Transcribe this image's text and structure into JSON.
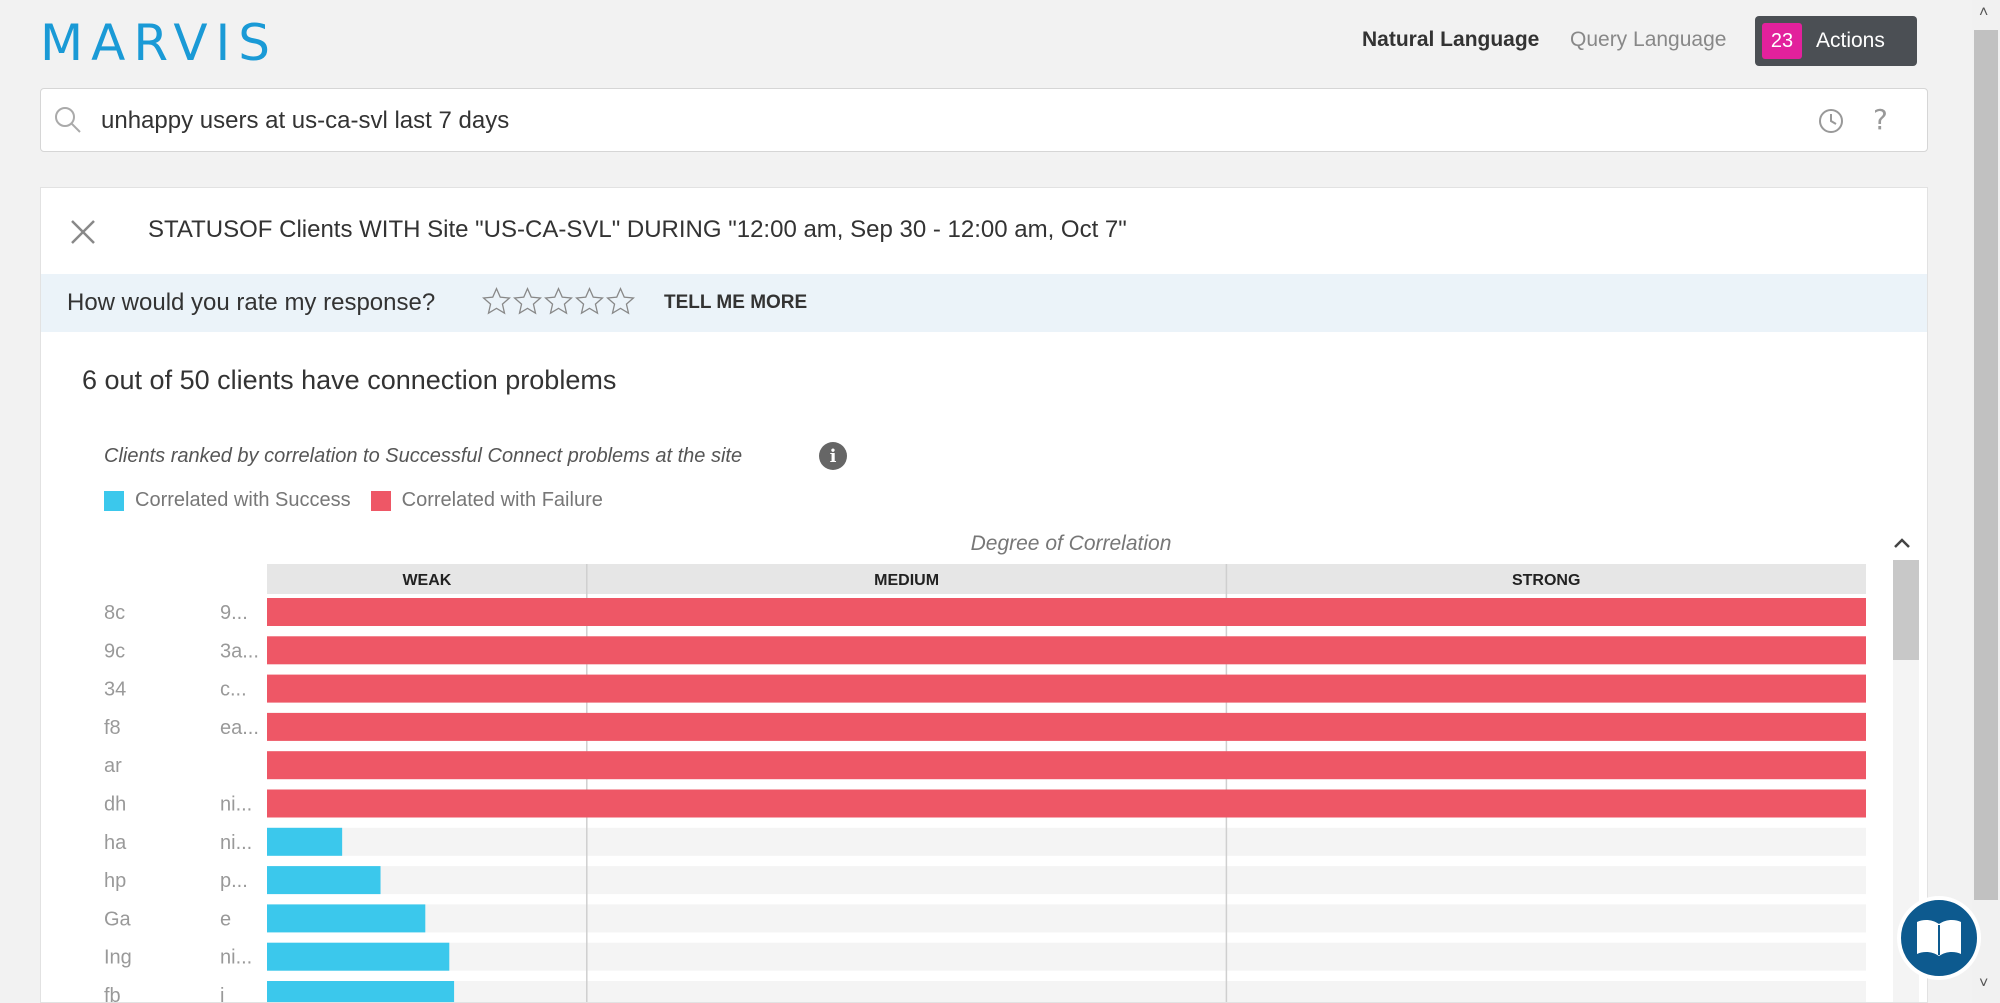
{
  "header": {
    "logo": "MARVIS",
    "mode_natural": "Natural Language",
    "mode_query": "Query Language",
    "actions_count": "23",
    "actions_label": "Actions"
  },
  "search": {
    "value": "unhappy users at us-ca-svl last 7 days"
  },
  "result": {
    "query_text": "STATUSOF Clients WITH Site \"US-CA-SVL\" DURING \"12:00 am, Sep 30 - 12:00 am, Oct 7\"",
    "rating_question": "How would you rate my response?",
    "rating_stars": 0,
    "rating_max": 5,
    "tell_more": "TELL ME MORE",
    "summary": "6 out of 50 clients have connection problems",
    "chart_subtitle": "Clients ranked by correlation to Successful Connect problems at the site",
    "info_icon": "i"
  },
  "colors": {
    "success": "#3bc8ec",
    "failure": "#ee5766",
    "logo": "#1a9ad6",
    "actions_badge": "#e2219c"
  },
  "chart_data": {
    "type": "bar",
    "orientation": "horizontal",
    "title": "Clients ranked by correlation to Successful Connect problems at the site",
    "xlabel": "Degree of Correlation",
    "bands": [
      "WEAK",
      "MEDIUM",
      "STRONG"
    ],
    "legend": [
      {
        "name": "Correlated with Success",
        "color": "#3bc8ec"
      },
      {
        "name": "Correlated with Failure",
        "color": "#ee5766"
      }
    ],
    "legend_position": "top-left",
    "xlim": [
      0,
      1
    ],
    "categories": [
      {
        "left": "8c",
        "right": "9..."
      },
      {
        "left": "9c",
        "right": "3a..."
      },
      {
        "left": "34",
        "right": "c..."
      },
      {
        "left": "f8",
        "right": "ea..."
      },
      {
        "left": "ar",
        "right": ""
      },
      {
        "left": "dh",
        "right": "ni..."
      },
      {
        "left": "ha",
        "right": "ni..."
      },
      {
        "left": "hp",
        "right": "p..."
      },
      {
        "left": "Ga",
        "right": "e"
      },
      {
        "left": "Ing",
        "right": "ni..."
      },
      {
        "left": "fb",
        "right": "i"
      }
    ],
    "series": [
      {
        "name": "Correlated with Failure",
        "color": "#ee5766",
        "values": [
          1.0,
          1.0,
          1.0,
          1.0,
          1.0,
          1.0,
          null,
          null,
          null,
          null,
          null
        ]
      },
      {
        "name": "Correlated with Success",
        "color": "#3bc8ec",
        "values": [
          null,
          null,
          null,
          null,
          null,
          null,
          0.047,
          0.071,
          0.099,
          0.114,
          0.117
        ]
      }
    ]
  }
}
